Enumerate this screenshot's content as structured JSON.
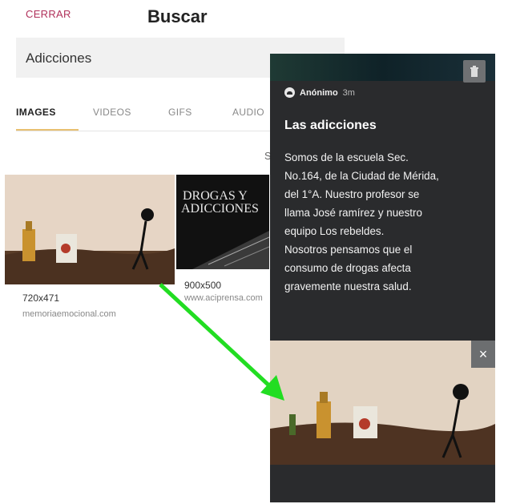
{
  "header": {
    "close_label": "CERRAR",
    "title": "Buscar"
  },
  "search": {
    "value": "Adicciones"
  },
  "tabs": [
    {
      "label": "IMAGES",
      "active": true
    },
    {
      "label": "VIDEOS"
    },
    {
      "label": "GIFS"
    },
    {
      "label": "AUDIO"
    }
  ],
  "results_partial_label": "S",
  "results": [
    {
      "dims": "720x471",
      "source": "memoriaemocional.com"
    },
    {
      "dims": "900x500",
      "source": "www.aciprensa.com",
      "thumb_text_line1": "DROGAS Y",
      "thumb_text_line2": "ADICCIONES"
    }
  ],
  "post": {
    "author": "Anónimo",
    "time": "3m",
    "title": "Las adicciones",
    "body": [
      "Somos de la escuela Sec.",
      "No.164, de la Ciudad de Mérida,",
      "del 1°A. Nuestro profesor se",
      "llama José ramírez y nuestro",
      "equipo Los rebeldes.",
      "Nosotros pensamos que el",
      "consumo de drogas afecta",
      "gravemente nuestra salud."
    ],
    "close_image_glyph": "×"
  },
  "colors": {
    "accent_close": "#b0305a",
    "arrow": "#22dd22",
    "post_bg": "#2a2b2d"
  }
}
